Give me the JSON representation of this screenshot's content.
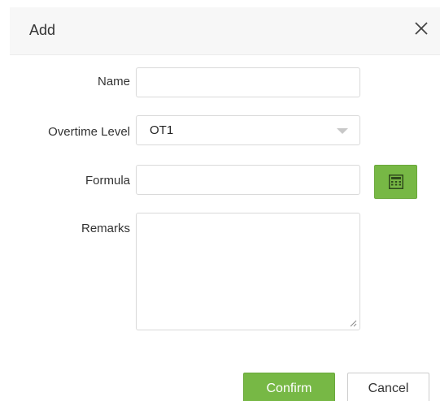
{
  "dialog": {
    "title": "Add",
    "close_icon": "close-icon"
  },
  "form": {
    "name": {
      "label": "Name",
      "value": ""
    },
    "overtime_level": {
      "label": "Overtime Level",
      "value": "OT1",
      "caret_icon": "caret-down-icon"
    },
    "formula": {
      "label": "Formula",
      "value": "",
      "calculator_icon": "calculator-icon"
    },
    "remarks": {
      "label": "Remarks",
      "value": ""
    }
  },
  "actions": {
    "confirm_label": "Confirm",
    "cancel_label": "Cancel"
  },
  "colors": {
    "accent": "#77b845",
    "header_bg": "#f7f7f7",
    "border": "#d9d9d9"
  }
}
